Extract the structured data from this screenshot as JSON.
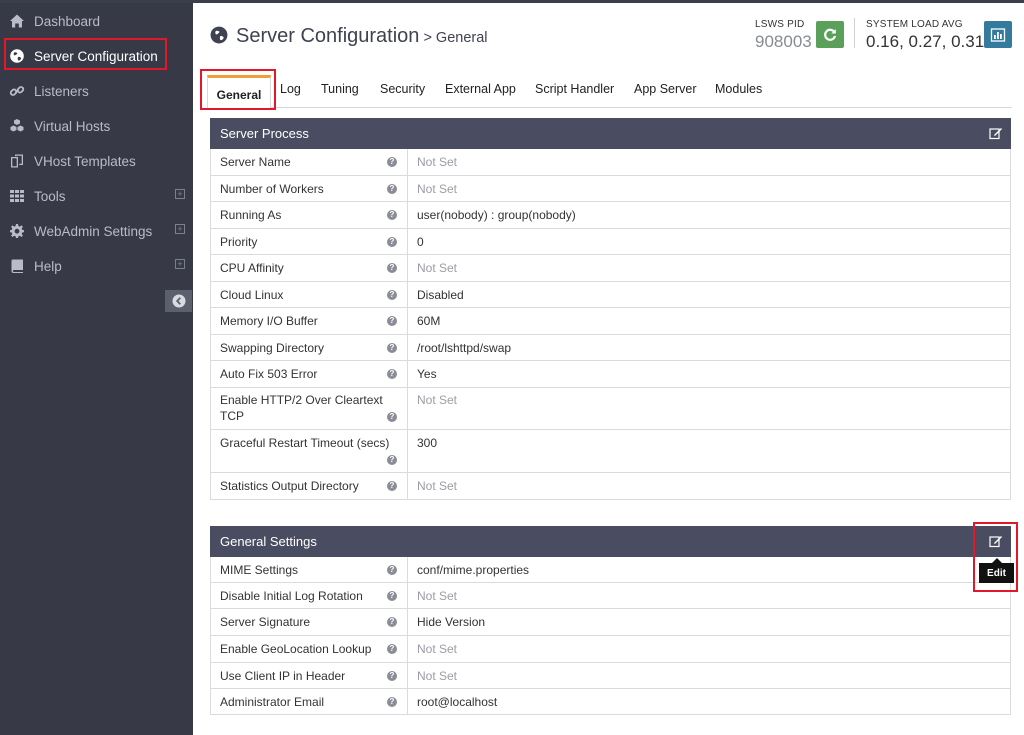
{
  "sidebar": {
    "items": [
      {
        "label": "Dashboard",
        "icon": "home-icon",
        "expandable": false,
        "active": false
      },
      {
        "label": "Server Configuration",
        "icon": "globe-icon",
        "expandable": false,
        "active": true
      },
      {
        "label": "Listeners",
        "icon": "link-icon",
        "expandable": false,
        "active": false
      },
      {
        "label": "Virtual Hosts",
        "icon": "cubes-icon",
        "expandable": false,
        "active": false
      },
      {
        "label": "VHost Templates",
        "icon": "copy-icon",
        "expandable": false,
        "active": false
      },
      {
        "label": "Tools",
        "icon": "grid-icon",
        "expandable": true,
        "active": false
      },
      {
        "label": "WebAdmin Settings",
        "icon": "gear-icon",
        "expandable": true,
        "active": false
      },
      {
        "label": "Help",
        "icon": "book-icon",
        "expandable": true,
        "active": false
      }
    ]
  },
  "header": {
    "title": "Server Configuration",
    "subtitle": "> General",
    "pid_label": "LSWS PID",
    "pid_value": "908003",
    "load_label": "SYSTEM LOAD AVG",
    "load_value": "0.16, 0.27, 0.31"
  },
  "tabs": [
    "General",
    "Log",
    "Tuning",
    "Security",
    "External App",
    "Script Handler",
    "App Server",
    "Modules"
  ],
  "server_process": {
    "title": "Server Process",
    "rows": [
      {
        "label": "Server Name",
        "value": "Not Set",
        "set": false
      },
      {
        "label": "Number of Workers",
        "value": "Not Set",
        "set": false
      },
      {
        "label": "Running As",
        "value": "user(nobody) : group(nobody)",
        "set": true
      },
      {
        "label": "Priority",
        "value": "0",
        "set": true
      },
      {
        "label": "CPU Affinity",
        "value": "Not Set",
        "set": false
      },
      {
        "label": "Cloud Linux",
        "value": "Disabled",
        "set": true
      },
      {
        "label": "Memory I/O Buffer",
        "value": "60M",
        "set": true
      },
      {
        "label": "Swapping Directory",
        "value": "/root/lshttpd/swap",
        "set": true
      },
      {
        "label": "Auto Fix 503 Error",
        "value": "Yes",
        "set": true
      },
      {
        "label": "Enable HTTP/2 Over Cleartext TCP",
        "value": "Not Set",
        "set": false
      },
      {
        "label": "Graceful Restart Timeout (secs)",
        "value": "300",
        "set": true
      },
      {
        "label": "Statistics Output Directory",
        "value": "Not Set",
        "set": false
      }
    ]
  },
  "general_settings": {
    "title": "General Settings",
    "edit_tooltip": "Edit",
    "rows": [
      {
        "label": "MIME Settings",
        "value": "conf/mime.properties",
        "set": true
      },
      {
        "label": "Disable Initial Log Rotation",
        "value": "Not Set",
        "set": false
      },
      {
        "label": "Server Signature",
        "value": "Hide Version",
        "set": true
      },
      {
        "label": "Enable GeoLocation Lookup",
        "value": "Not Set",
        "set": false
      },
      {
        "label": "Use Client IP in Header",
        "value": "Not Set",
        "set": false
      },
      {
        "label": "Administrator Email",
        "value": "root@localhost",
        "set": true
      }
    ]
  },
  "colors": {
    "sidebar_bg": "#373a46",
    "panel_header": "#4a4d61",
    "tab_accent": "#f39d36",
    "restart_green": "#5a9f5a",
    "chart_blue": "#337a9c",
    "highlight_red": "#e3172a"
  }
}
